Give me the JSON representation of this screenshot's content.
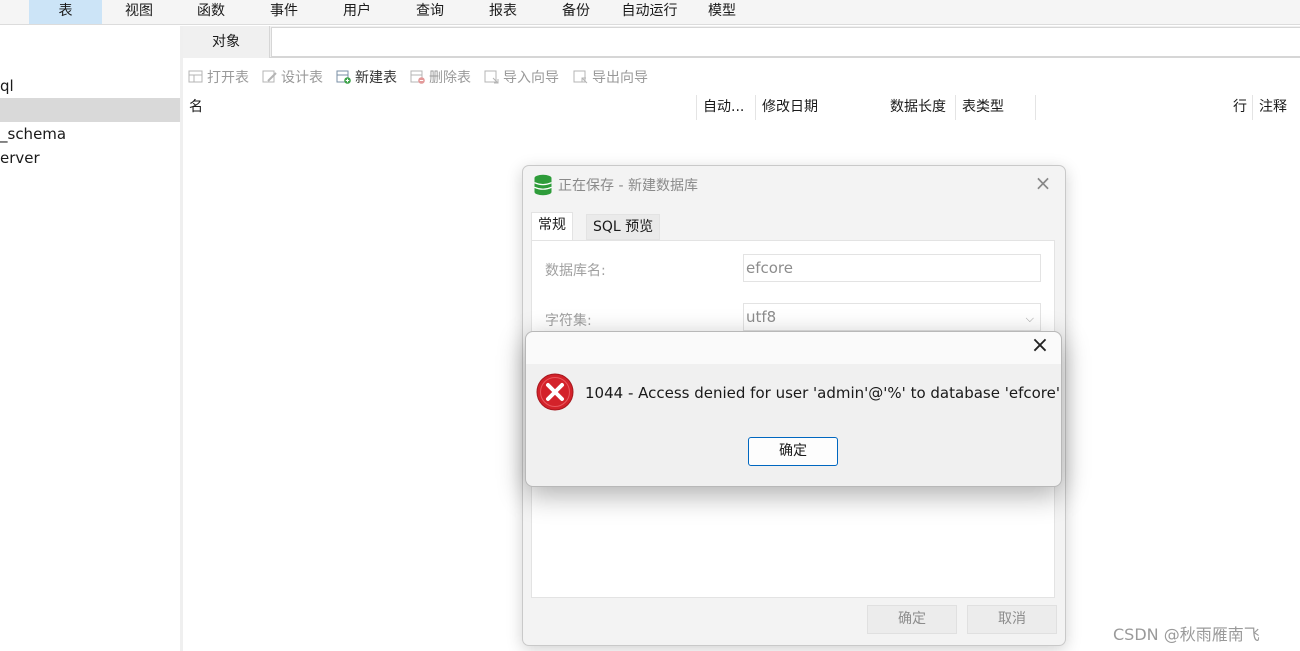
{
  "menu": {
    "items": [
      "表",
      "视图",
      "函数",
      "事件",
      "用户",
      "查询",
      "报表",
      "备份",
      "自动运行",
      "模型"
    ],
    "active_index": 0
  },
  "tree": {
    "items": [
      "ql",
      "",
      "_schema",
      "erver"
    ],
    "selected_index": 1
  },
  "tabs": {
    "objects": "对象"
  },
  "toolbar": {
    "open_table": "打开表",
    "design_table": "设计表",
    "new_table": "新建表",
    "delete_table": "删除表",
    "import_wizard": "导入向导",
    "export_wizard": "导出向导"
  },
  "columns": [
    "名",
    "自动...",
    "修改日期",
    "数据长度",
    "表类型",
    "",
    "行",
    "注释"
  ],
  "save_dialog": {
    "title": "正在保存 - 新建数据库",
    "tabs": {
      "general": "常规",
      "sql_preview": "SQL 预览"
    },
    "db_name_label": "数据库名:",
    "db_name_value": "efcore",
    "charset_label": "字符集:",
    "charset_value": "utf8",
    "ok": "确定",
    "cancel": "取消"
  },
  "error_dialog": {
    "message": "1044 - Access denied for user 'admin'@'%' to database 'efcore'",
    "ok": "确定"
  },
  "watermark": "CSDN @秋雨雁南飞",
  "colors": {
    "menu_active": "#cce4f7",
    "error_red": "#d3222a",
    "db_icon_green": "#2e9c3a",
    "ok_border": "#0067c0"
  }
}
